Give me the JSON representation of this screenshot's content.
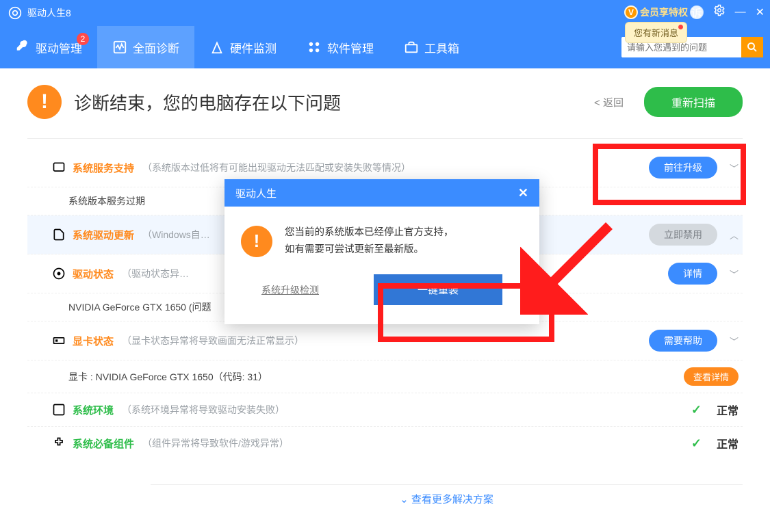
{
  "app": {
    "title": "驱动人生8"
  },
  "vip": {
    "label": "会员享特权",
    "msg": "您有新消息",
    "su": "诉"
  },
  "nav": {
    "tabs": [
      {
        "label": "驱动管理",
        "badge": "2"
      },
      {
        "label": "全面诊断"
      },
      {
        "label": "硬件监测"
      },
      {
        "label": "软件管理"
      },
      {
        "label": "工具箱"
      }
    ],
    "search_placeholder": "请输入您遇到的问题"
  },
  "diag": {
    "title": "诊断结束，您的电脑存在以下问题",
    "back": "返回",
    "rescan": "重新扫描"
  },
  "rows": {
    "sys_service": {
      "title": "系统服务支持",
      "desc": "（系统版本过低将有可能出现驱动无法匹配或安装失败等情况）",
      "sub": "系统版本服务过期",
      "btn": "前往升级"
    },
    "sys_driver": {
      "title": "系统驱动更新",
      "desc": "（Windows自…",
      "btn": "立即禁用"
    },
    "driver_state": {
      "title": "驱动状态",
      "desc": "（驱动状态异…",
      "sub": "NVIDIA GeForce GTX 1650 (问题",
      "btn": "详情"
    },
    "gpu_state": {
      "title": "显卡状态",
      "desc": "（显卡状态异常将导致画面无法正常显示）",
      "sub": "显卡 : NVIDIA GeForce GTX 1650（代码: 31）",
      "btn": "需要帮助",
      "detail_btn": "查看详情"
    },
    "sys_env": {
      "title": "系统环境",
      "desc": "（系统环境异常将导致驱动安装失败）",
      "status": "正常"
    },
    "sys_comp": {
      "title": "系统必备组件",
      "desc": "（组件异常将导致软件/游戏异常）",
      "status": "正常"
    }
  },
  "more": "查看更多解决方案",
  "modal": {
    "title": "驱动人生",
    "line1": "您当前的系统版本已经停止官方支持，",
    "line2": "如有需要可尝试更新至最新版。",
    "check_link": "系统升级检测",
    "primary_btn": "一键重装"
  }
}
